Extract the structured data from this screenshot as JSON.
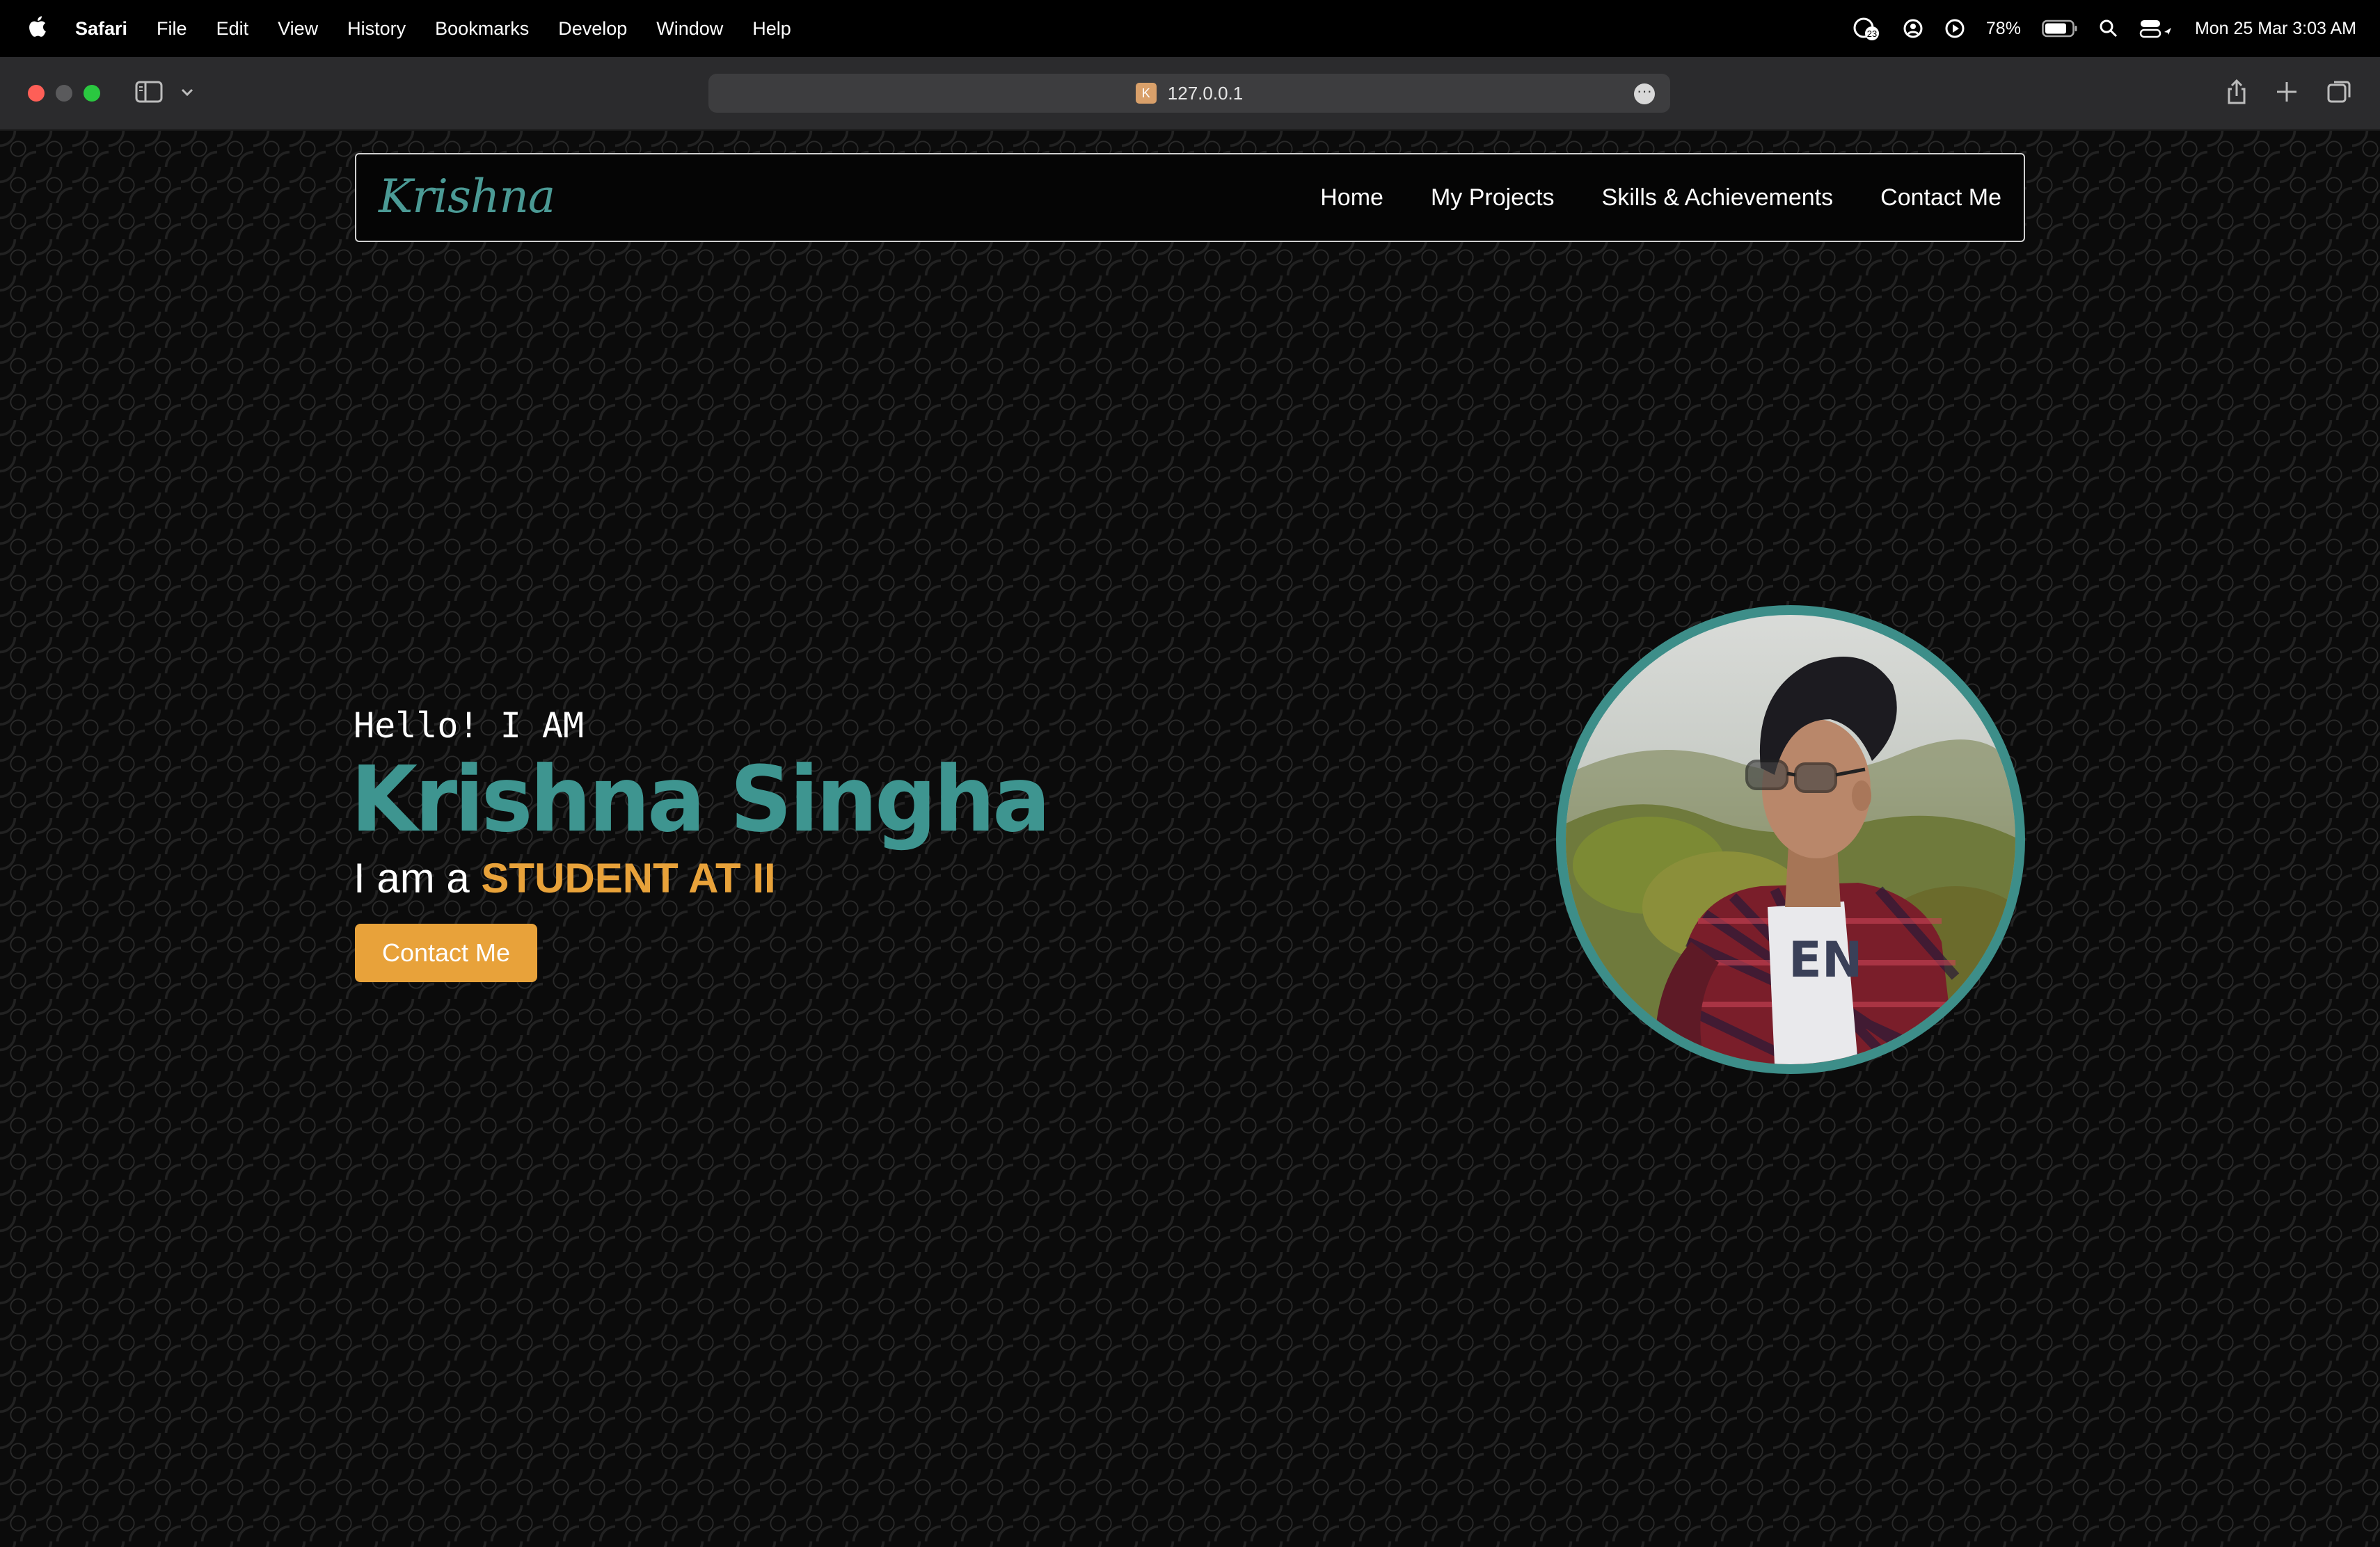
{
  "menubar": {
    "app": "Safari",
    "items": [
      "File",
      "Edit",
      "View",
      "History",
      "Bookmarks",
      "Develop",
      "Window",
      "Help"
    ],
    "battery": "78%",
    "datetime": "Mon 25 Mar  3:03 AM",
    "badge": "23"
  },
  "browser": {
    "url": "127.0.0.1",
    "favicon_letter": "K"
  },
  "site": {
    "logo": "Krishna",
    "nav": [
      "Home",
      "My Projects",
      "Skills & Achievements",
      "Contact Me"
    ],
    "greeting": "Hello! I AM",
    "name": "Krishna Singha",
    "role_prefix": "I am a ",
    "role": "STUDENT AT II",
    "cta": "Contact Me"
  },
  "colors": {
    "accent_teal": "#3e9590",
    "accent_orange": "#e8a23a"
  }
}
